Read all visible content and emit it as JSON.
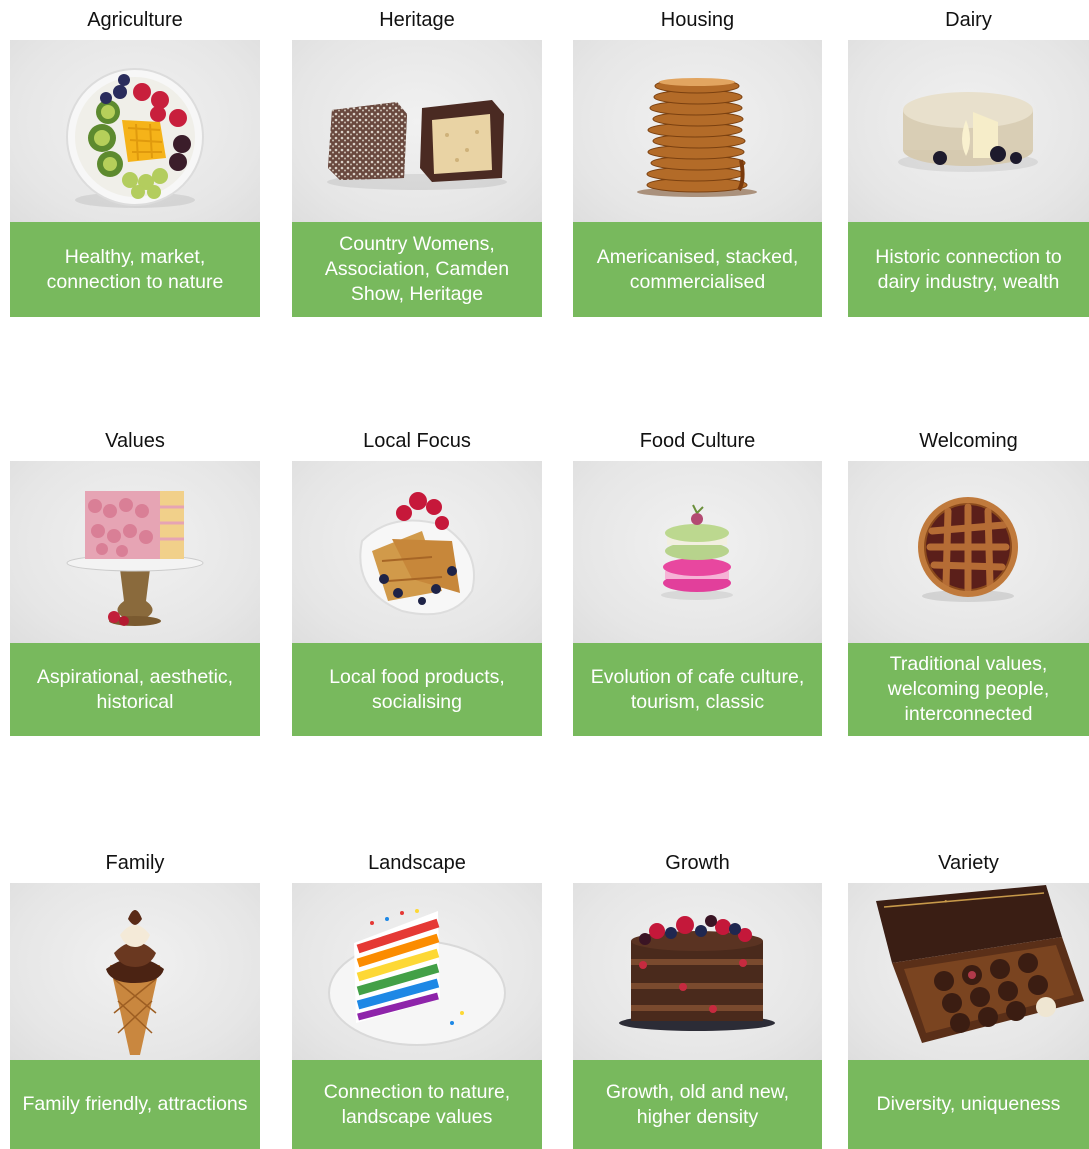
{
  "cards": [
    {
      "title": "Agriculture",
      "caption": "Healthy, market, connection to nature",
      "icon": "fruit-platter-icon"
    },
    {
      "title": "Heritage",
      "caption": "Country Womens, Association, Camden Show, Heritage",
      "icon": "lamington-icon"
    },
    {
      "title": "Housing",
      "caption": "Americanised, stacked, commercialised",
      "icon": "pancake-stack-icon"
    },
    {
      "title": "Dairy",
      "caption": "Historic connection to dairy industry, wealth",
      "icon": "cheese-wheel-icon"
    },
    {
      "title": "Values",
      "caption": "Aspirational, aesthetic, historical",
      "icon": "layer-cake-icon"
    },
    {
      "title": "Local Focus",
      "caption": "Local food products, socialising",
      "icon": "crepes-icon"
    },
    {
      "title": "Food Culture",
      "caption": "Evolution of cafe culture, tourism, classic",
      "icon": "macarons-icon"
    },
    {
      "title": "Welcoming",
      "caption": "Traditional values, welcoming people, interconnected",
      "icon": "lattice-pie-icon"
    },
    {
      "title": "Family",
      "caption": "Family friendly, attractions",
      "icon": "ice-cream-cone-icon"
    },
    {
      "title": "Landscape",
      "caption": "Connection to nature, landscape values",
      "icon": "rainbow-cake-icon"
    },
    {
      "title": "Growth",
      "caption": "Growth, old and new, higher density",
      "icon": "naked-cake-icon"
    },
    {
      "title": "Variety",
      "caption": "Diversity, uniqueness",
      "icon": "chocolate-box-icon"
    }
  ],
  "colors": {
    "caption_bg": "#78b95d",
    "caption_text": "#ffffff",
    "image_bg": "#e6e6e6"
  }
}
